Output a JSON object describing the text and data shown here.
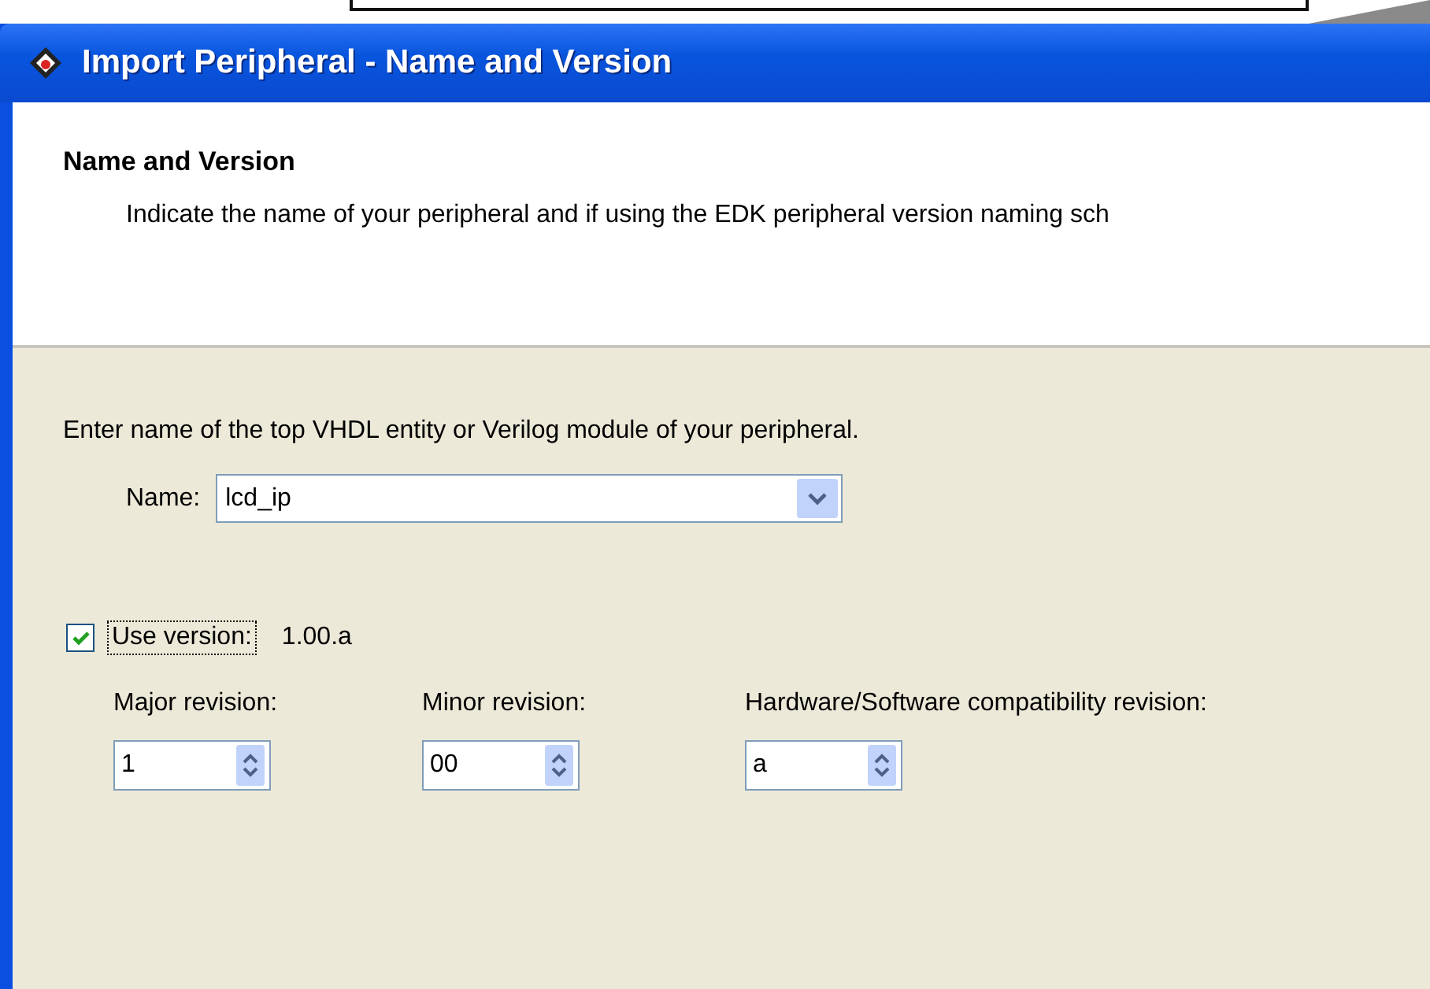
{
  "window": {
    "title": "Import Peripheral - Name and Version"
  },
  "header": {
    "title": "Name and Version",
    "description": "Indicate the name of your peripheral and if using the EDK peripheral version naming sch"
  },
  "prompt": "Enter name of the top VHDL entity or Verilog module of your peripheral.",
  "name_field": {
    "label": "Name:",
    "value": "lcd_ip"
  },
  "use_version": {
    "label": "Use version:",
    "checked": true,
    "focused": true,
    "value": "1.00.a"
  },
  "revisions": [
    {
      "label": "Major revision:",
      "value": "1"
    },
    {
      "label": "Minor revision:",
      "value": "00"
    },
    {
      "label": "Hardware/Software compatibility revision:",
      "value": "a"
    }
  ]
}
